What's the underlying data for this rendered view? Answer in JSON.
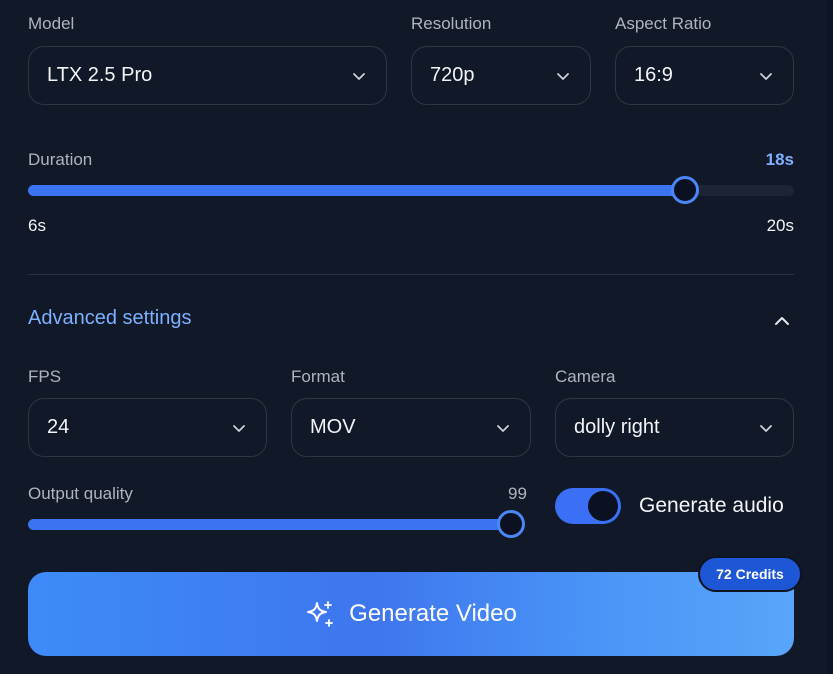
{
  "model": {
    "label": "Model",
    "value": "LTX 2.5 Pro"
  },
  "resolution": {
    "label": "Resolution",
    "value": "720p"
  },
  "aspect_ratio": {
    "label": "Aspect Ratio",
    "value": "16:9"
  },
  "duration": {
    "label": "Duration",
    "value_text": "18s",
    "min_text": "6s",
    "max_text": "20s",
    "value": 18,
    "min": 6,
    "max": 20
  },
  "advanced": {
    "label": "Advanced settings",
    "expanded": true
  },
  "fps": {
    "label": "FPS",
    "value": "24"
  },
  "format": {
    "label": "Format",
    "value": "MOV"
  },
  "camera": {
    "label": "Camera",
    "value": "dolly right"
  },
  "output_quality": {
    "label": "Output quality",
    "value_text": "99",
    "value": 99,
    "max": 100
  },
  "generate_audio": {
    "label": "Generate audio",
    "enabled": true
  },
  "generate_button": {
    "label": "Generate Video",
    "icon": "sparkles-icon"
  },
  "credits_badge": {
    "label": "72 Credits"
  },
  "colors": {
    "accent": "#3b73f0",
    "link": "#7db0ff",
    "background": "#111827"
  }
}
